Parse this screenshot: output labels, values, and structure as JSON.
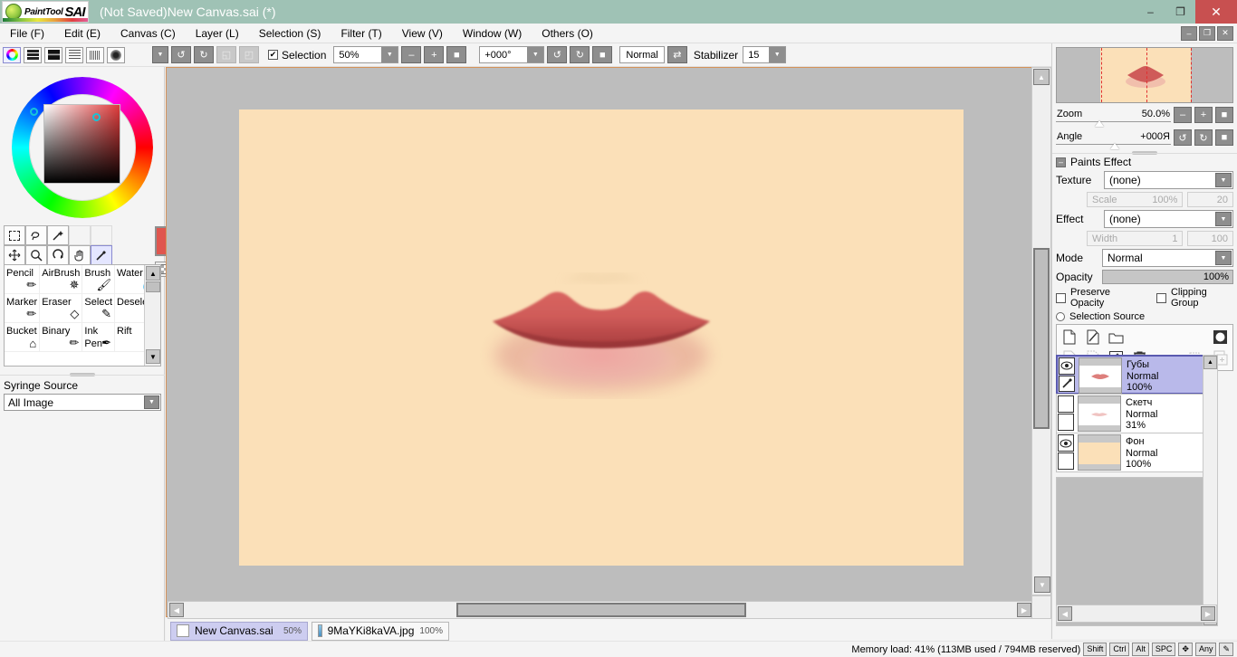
{
  "window": {
    "brand_paint": "PaintTool",
    "brand_sai": "SAI",
    "title": "(Not Saved)New Canvas.sai (*)",
    "minimize": "–",
    "restore": "❐",
    "close": "✕"
  },
  "menubar": {
    "items": [
      {
        "label": "File (F)"
      },
      {
        "label": "Edit (E)"
      },
      {
        "label": "Canvas (C)"
      },
      {
        "label": "Layer (L)"
      },
      {
        "label": "Selection (S)"
      },
      {
        "label": "Filter (T)"
      },
      {
        "label": "View (V)"
      },
      {
        "label": "Window (W)"
      },
      {
        "label": "Others (O)"
      }
    ],
    "doc_minimize": "–",
    "doc_restore": "❐",
    "doc_close": "✕"
  },
  "toolbar": {
    "panel_icons": [
      "color-wheel",
      "rgb-sliders",
      "gradient-bar",
      "swatch-list",
      "swatch-grid",
      "blob"
    ],
    "dropdown": "▼",
    "undo": "↺",
    "redo": "↻",
    "flip_h": "◱",
    "flip_v": "◰",
    "selection_label": "Selection",
    "selection_checked": "✔",
    "zoom_value": "50%",
    "zoom_out": "–",
    "zoom_in": "+",
    "zoom_reset": "■",
    "angle_value": "+000°",
    "rotate_ccw": "↺",
    "rotate_cw": "↻",
    "rotate_reset": "■",
    "blend_mode": "Normal",
    "swap_icon": "⇄",
    "stabilizer_label": "Stabilizer",
    "stabilizer_value": "15"
  },
  "left_panel": {
    "tools_row1": [
      "select-rect",
      "select-lasso",
      "magic-wand",
      "",
      ""
    ],
    "tools_row2": [
      "move",
      "zoom",
      "rotate",
      "hand",
      "eyedropper"
    ],
    "tool_glyphs_1": [
      "⬚",
      "◠",
      "✨",
      "",
      ""
    ],
    "tool_glyphs_2": [
      "✥",
      "🔍",
      "↻",
      "✋",
      "✎"
    ],
    "active_tool": "eyedropper",
    "foreground_color": "#e0564e",
    "background_color": "#0d6b1b",
    "swap_icon": "⇅",
    "brushes": [
      {
        "name": "Pencil",
        "icon": "✏"
      },
      {
        "name": "AirBrush",
        "icon": "✵"
      },
      {
        "name": "Brush",
        "icon": "🖌"
      },
      {
        "name": "Water",
        "icon": "💧"
      },
      {
        "name": "Marker",
        "icon": "✏"
      },
      {
        "name": "Eraser",
        "icon": "◇"
      },
      {
        "name": "Select",
        "icon": "✎"
      },
      {
        "name": "Deselect",
        "icon": "◈"
      },
      {
        "name": "Bucket",
        "icon": "🪣"
      },
      {
        "name": "Binary",
        "icon": "✏"
      },
      {
        "name": "Ink Pen",
        "icon": "✒"
      },
      {
        "name": "Rift",
        "icon": "✵"
      }
    ],
    "syringe_label": "Syringe Source",
    "syringe_value": "All Image",
    "scroll_up": "▲",
    "scroll_down": "▼"
  },
  "canvas": {
    "background_color": "#fbe0b8",
    "workspace_color": "#bdbdbd",
    "scroll_left": "◀",
    "scroll_right": "▶",
    "scroll_up": "▲",
    "scroll_down": "▼"
  },
  "doc_tabs": [
    {
      "name": "New Canvas.sai",
      "zoom": "50%",
      "active": true,
      "icon": "document-icon"
    },
    {
      "name": "9MaYKi8kaVA.jpg",
      "zoom": "100%",
      "active": false,
      "icon": "image-icon"
    }
  ],
  "navigator": {
    "zoom_label": "Zoom",
    "zoom_value": "50.0%",
    "angle_label": "Angle",
    "angle_value": "+000Я",
    "zoom_out": "–",
    "zoom_in": "+",
    "zoom_reset": "■",
    "rotate_ccw": "↺",
    "rotate_cw": "↻",
    "rotate_reset": "■"
  },
  "paints_effect": {
    "title": "Paints Effect",
    "collapse_icon": "–",
    "texture_label": "Texture",
    "texture_value": "(none)",
    "scale_label": "Scale",
    "scale_value": "100%",
    "scale_num": "20",
    "effect_label": "Effect",
    "effect_value": "(none)",
    "width_label": "Width",
    "width_value": "1",
    "width_num": "100",
    "mode_label": "Mode",
    "mode_value": "Normal",
    "opacity_label": "Opacity",
    "opacity_value": "100%",
    "preserve_opacity": "Preserve Opacity",
    "clipping_group": "Clipping Group",
    "selection_source": "Selection Source"
  },
  "layer_toolbar": {
    "new_layer": "new-layer-icon",
    "new_linework": "new-linework-icon",
    "new_folder": "new-folder-icon",
    "mask": "mask-icon",
    "merge_down": "merge-down-icon",
    "merge_group": "merge-group-icon",
    "clear": "clear-icon",
    "delete": "delete-icon",
    "transfer": "transfer-icon",
    "duplicate": "duplicate-icon"
  },
  "layers": [
    {
      "name": "Губы",
      "mode": "Normal",
      "opacity": "100%",
      "visible": true,
      "selected": true,
      "thumb": "lips",
      "eye": "👁",
      "pen": "✎"
    },
    {
      "name": "Скетч",
      "mode": "Normal",
      "opacity": "31%",
      "visible": false,
      "selected": false,
      "thumb": "sketch",
      "eye": "",
      "pen": ""
    },
    {
      "name": "Фон",
      "mode": "Normal",
      "opacity": "100%",
      "visible": true,
      "selected": false,
      "thumb": "bg",
      "eye": "👁",
      "pen": ""
    }
  ],
  "statusbar": {
    "memory": "Memory load: 41% (113MB used / 794MB reserved)",
    "keys": [
      "Shift",
      "Ctrl",
      "Alt",
      "SPC",
      "✥",
      "Any",
      "✎"
    ]
  }
}
